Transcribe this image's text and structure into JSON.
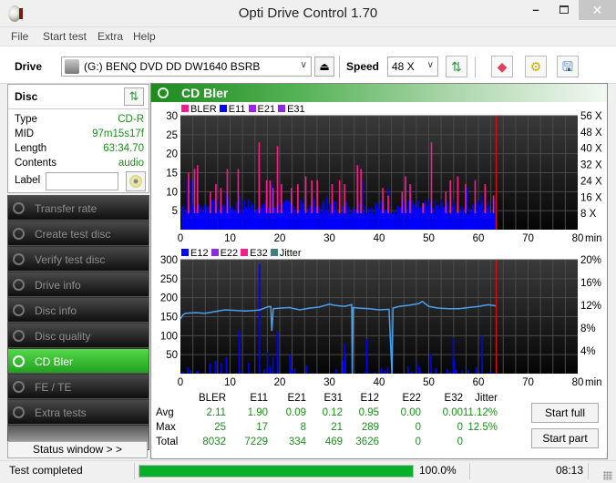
{
  "window": {
    "title": "Opti Drive Control 1.70",
    "minimize": "–",
    "close": "✕"
  },
  "menu": [
    "File",
    "Start test",
    "Extra",
    "Help"
  ],
  "toolbar": {
    "drive_label": "Drive",
    "drive_value": "(G:)  BENQ DVD DD DW1640 BSRB",
    "speed_label": "Speed",
    "speed_value": "48 X",
    "icons": [
      "drive-icon",
      "eject-icon",
      "refresh-icon",
      "erase-icon",
      "settings-icon",
      "save-icon"
    ]
  },
  "disc": {
    "title": "Disc",
    "rows": [
      {
        "key": "Type",
        "value": "CD-R"
      },
      {
        "key": "MID",
        "value": "97m15s17f"
      },
      {
        "key": "Length",
        "value": "63:34.70"
      },
      {
        "key": "Contents",
        "value": "audio"
      }
    ],
    "label_key": "Label",
    "label_value": ""
  },
  "nav": [
    {
      "label": "Transfer rate",
      "active": false
    },
    {
      "label": "Create test disc",
      "active": false
    },
    {
      "label": "Verify test disc",
      "active": false
    },
    {
      "label": "Drive info",
      "active": false
    },
    {
      "label": "Disc info",
      "active": false
    },
    {
      "label": "Disc quality",
      "active": false
    },
    {
      "label": "CD Bler",
      "active": true
    },
    {
      "label": "FE / TE",
      "active": false
    },
    {
      "label": "Extra tests",
      "active": false
    }
  ],
  "status_window_label": "Status window > >",
  "main": {
    "title": "CD Bler"
  },
  "chart_data": [
    {
      "type": "bar",
      "title": "CD Bler upper",
      "legend": [
        {
          "name": "BLER",
          "color": "#ff1a8c"
        },
        {
          "name": "E11",
          "color": "#0000ff"
        },
        {
          "name": "E21",
          "color": "#a020f0"
        },
        {
          "name": "E31",
          "color": "#8a2be2"
        }
      ],
      "xlabel": "min",
      "x_ticks": [
        0,
        10,
        20,
        30,
        40,
        50,
        60,
        70,
        80
      ],
      "xlim": [
        0,
        80
      ],
      "y_ticks": [
        5,
        10,
        15,
        20,
        25,
        30
      ],
      "ylim": [
        0,
        30
      ],
      "y2_ticks": [
        "8 X",
        "16 X",
        "24 X",
        "32 X",
        "40 X",
        "48 X",
        "56 X"
      ],
      "y2lim": [
        0,
        56
      ],
      "end_marker_min": 63.58,
      "bler_peaks": [
        [
          1.5,
          15
        ],
        [
          2.7,
          16
        ],
        [
          3.3,
          17
        ],
        [
          5.9,
          10
        ],
        [
          7,
          12
        ],
        [
          8,
          11
        ],
        [
          9.3,
          16
        ],
        [
          11.5,
          16
        ],
        [
          15.7,
          23
        ],
        [
          17.2,
          13
        ],
        [
          17.9,
          13
        ],
        [
          18.5,
          11
        ],
        [
          19.4,
          22
        ],
        [
          20.2,
          12
        ],
        [
          22.2,
          11
        ],
        [
          23.5,
          12
        ],
        [
          25.1,
          14
        ],
        [
          26.3,
          13
        ],
        [
          27.4,
          13
        ],
        [
          30.4,
          12
        ],
        [
          31.9,
          13
        ],
        [
          32.9,
          12
        ],
        [
          35.5,
          17
        ],
        [
          36.2,
          16
        ],
        [
          40.6,
          11
        ],
        [
          41.7,
          9
        ],
        [
          44.5,
          10
        ],
        [
          45.2,
          14
        ],
        [
          46.1,
          12
        ],
        [
          48.7,
          7
        ],
        [
          50.4,
          23
        ],
        [
          53.3,
          10
        ],
        [
          54.2,
          13
        ],
        [
          55.7,
          14
        ],
        [
          57.3,
          12
        ],
        [
          59.2,
          13
        ],
        [
          61.2,
          12
        ],
        [
          62.9,
          9
        ]
      ],
      "e11_level": 4,
      "e11_peaks": [
        [
          1.2,
          13
        ],
        [
          2.1,
          13
        ],
        [
          3.2,
          15
        ],
        [
          6,
          8
        ],
        [
          9.2,
          10
        ],
        [
          11.8,
          9
        ],
        [
          13.6,
          8
        ],
        [
          15.8,
          20
        ],
        [
          18.4,
          12
        ],
        [
          19.5,
          12
        ],
        [
          24.1,
          8
        ],
        [
          29.4,
          9
        ],
        [
          35.6,
          17
        ],
        [
          36.5,
          13
        ],
        [
          41.7,
          11
        ],
        [
          46.3,
          11
        ],
        [
          52.3,
          8
        ],
        [
          57.6,
          11
        ],
        [
          60.4,
          9
        ],
        [
          63,
          8
        ]
      ]
    },
    {
      "type": "bar",
      "title": "CD Bler lower",
      "legend": [
        {
          "name": "E12",
          "color": "#0000ff"
        },
        {
          "name": "E22",
          "color": "#8a2be2"
        },
        {
          "name": "E32",
          "color": "#ff1a8c"
        },
        {
          "name": "Jitter",
          "color": "#3f7f7f"
        }
      ],
      "xlabel": "min",
      "x_ticks": [
        0,
        10,
        20,
        30,
        40,
        50,
        60,
        70,
        80
      ],
      "xlim": [
        0,
        80
      ],
      "y_ticks": [
        50,
        100,
        150,
        200,
        250,
        300
      ],
      "ylim": [
        0,
        300
      ],
      "y2_ticks": [
        "4%",
        "8%",
        "12%",
        "16%",
        "20%"
      ],
      "y2lim": [
        0,
        20
      ],
      "end_marker_min": 63.58,
      "e12_bars": [
        [
          0.3,
          5
        ],
        [
          1.3,
          17
        ],
        [
          1.9,
          10
        ],
        [
          3.1,
          5
        ],
        [
          3.4,
          7
        ],
        [
          5.8,
          26
        ],
        [
          6.9,
          33
        ],
        [
          8.1,
          27
        ],
        [
          9.1,
          43
        ],
        [
          11.7,
          114
        ],
        [
          12.2,
          5
        ],
        [
          13.6,
          28
        ],
        [
          15.8,
          289
        ],
        [
          16.7,
          12
        ],
        [
          17.4,
          56
        ],
        [
          17.9,
          18
        ],
        [
          18.5,
          44
        ],
        [
          19.4,
          110
        ],
        [
          21.9,
          50
        ],
        [
          22.4,
          10
        ],
        [
          22.9,
          15
        ],
        [
          25.2,
          22
        ],
        [
          26.5,
          3
        ],
        [
          31.2,
          12
        ],
        [
          32.6,
          35
        ],
        [
          32.9,
          78
        ],
        [
          33.1,
          48
        ],
        [
          36.9,
          3
        ],
        [
          37.4,
          91
        ],
        [
          39,
          5
        ],
        [
          40.3,
          15
        ],
        [
          41,
          9
        ],
        [
          41.6,
          18
        ],
        [
          45.7,
          20
        ],
        [
          46.4,
          5
        ],
        [
          47.5,
          28
        ],
        [
          48,
          17
        ],
        [
          50.3,
          53
        ],
        [
          51.3,
          14
        ],
        [
          53.6,
          13
        ],
        [
          54.1,
          5
        ],
        [
          54.8,
          95
        ],
        [
          55,
          37
        ],
        [
          55.4,
          10
        ],
        [
          56.6,
          8
        ],
        [
          57.8,
          10
        ],
        [
          59.4,
          17
        ],
        [
          60.6,
          100
        ],
        [
          62.3,
          5
        ]
      ],
      "jitter_series": [
        [
          0,
          9.6
        ],
        [
          0.5,
          10.3
        ],
        [
          1,
          10.6
        ],
        [
          3,
          10.7
        ],
        [
          5,
          10.6
        ],
        [
          7,
          10.9
        ],
        [
          9,
          11.2
        ],
        [
          11,
          11.1
        ],
        [
          13,
          11.0
        ],
        [
          15,
          11.1
        ],
        [
          16,
          11.2
        ],
        [
          17.5,
          11.7
        ],
        [
          18.2,
          11.8
        ],
        [
          18.4,
          7.5
        ],
        [
          18.7,
          11.4
        ],
        [
          20,
          11.5
        ],
        [
          22,
          11.6
        ],
        [
          24,
          11.2
        ],
        [
          26,
          11.5
        ],
        [
          28,
          11.7
        ],
        [
          30,
          12.2
        ],
        [
          31,
          12.0
        ],
        [
          33,
          11.8
        ],
        [
          34.5,
          12.1
        ],
        [
          34.6,
          0
        ],
        [
          34.8,
          11.6
        ],
        [
          36,
          11.5
        ],
        [
          38,
          11.4
        ],
        [
          40,
          11.2
        ],
        [
          42,
          11.3
        ],
        [
          42.6,
          0
        ],
        [
          42.8,
          11.5
        ],
        [
          44,
          11.8
        ],
        [
          46,
          12.0
        ],
        [
          48,
          12.3
        ],
        [
          48.7,
          12.7
        ],
        [
          50,
          11.8
        ],
        [
          52,
          11.5
        ],
        [
          54,
          11.4
        ],
        [
          56,
          11.4
        ],
        [
          58,
          11.6
        ],
        [
          60,
          11.8
        ],
        [
          62,
          12.1
        ],
        [
          63.5,
          11.9
        ]
      ]
    }
  ],
  "stats": {
    "headers": [
      "BLER",
      "E11",
      "E21",
      "E31",
      "E12",
      "E22",
      "E32",
      "Jitter"
    ],
    "rows": [
      {
        "label": "Avg",
        "values": [
          "2.11",
          "1.90",
          "0.09",
          "0.12",
          "0.95",
          "0.00",
          "0.00",
          "11.12%"
        ]
      },
      {
        "label": "Max",
        "values": [
          "25",
          "17",
          "8",
          "21",
          "289",
          "0",
          "0",
          "12.5%"
        ]
      },
      {
        "label": "Total",
        "values": [
          "8032",
          "7229",
          "334",
          "469",
          "3626",
          "0",
          "0",
          ""
        ]
      }
    ]
  },
  "buttons": {
    "start_full": "Start full",
    "start_part": "Start part"
  },
  "statusbar": {
    "text": "Test completed",
    "progress": 100.0,
    "progress_text": "100.0%",
    "time": "08:13"
  }
}
